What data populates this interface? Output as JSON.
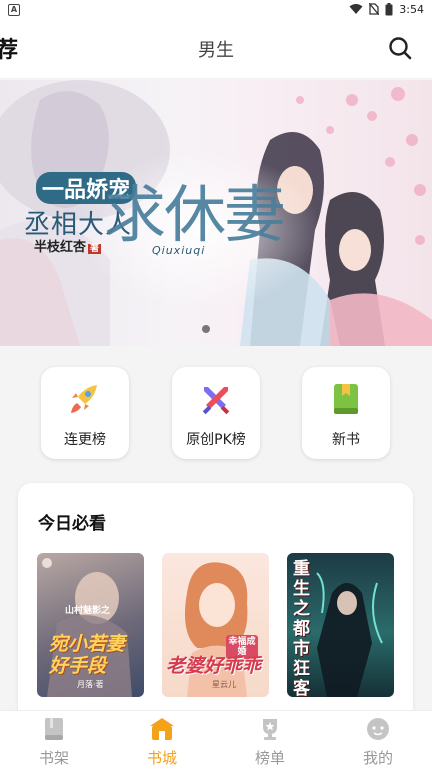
{
  "status_bar": {
    "time": "3:54",
    "app_badge": "A"
  },
  "header": {
    "left_tab": "荐",
    "center_tab": "男生",
    "search_icon": "search-icon"
  },
  "banner": {
    "title_line1": "一品娇宠",
    "title_line2": "丞相大人",
    "title_big": "求休妻",
    "pinyin": "Qiuxiuqi",
    "author": "半枝红杏",
    "author_tag": "著",
    "page_indicator": "1"
  },
  "menu": {
    "items": [
      {
        "label": "连更榜",
        "icon": "rocket-icon"
      },
      {
        "label": "原创PK榜",
        "icon": "crossed-swords-icon"
      },
      {
        "label": "新书",
        "icon": "book-icon"
      }
    ]
  },
  "today": {
    "title": "今日必看",
    "books": [
      {
        "cover_text": "宛小若妻好手段",
        "cover_top": "山村魅影之",
        "author": "月落·著"
      },
      {
        "cover_text": "老婆好乖乖",
        "cover_tag": "幸福成婚",
        "author": "星云儿"
      },
      {
        "cover_text": "重生之都市狂客",
        "author": ""
      }
    ]
  },
  "bottom_nav": {
    "items": [
      {
        "label": "书架",
        "icon": "bookshelf-icon",
        "active": false
      },
      {
        "label": "书城",
        "icon": "bookstore-icon",
        "active": true
      },
      {
        "label": "榜单",
        "icon": "ranking-icon",
        "active": false
      },
      {
        "label": "我的",
        "icon": "profile-icon",
        "active": false
      }
    ]
  },
  "colors": {
    "accent": "#f5a21b",
    "inactive": "#999999",
    "background": "#f4f4f4"
  }
}
